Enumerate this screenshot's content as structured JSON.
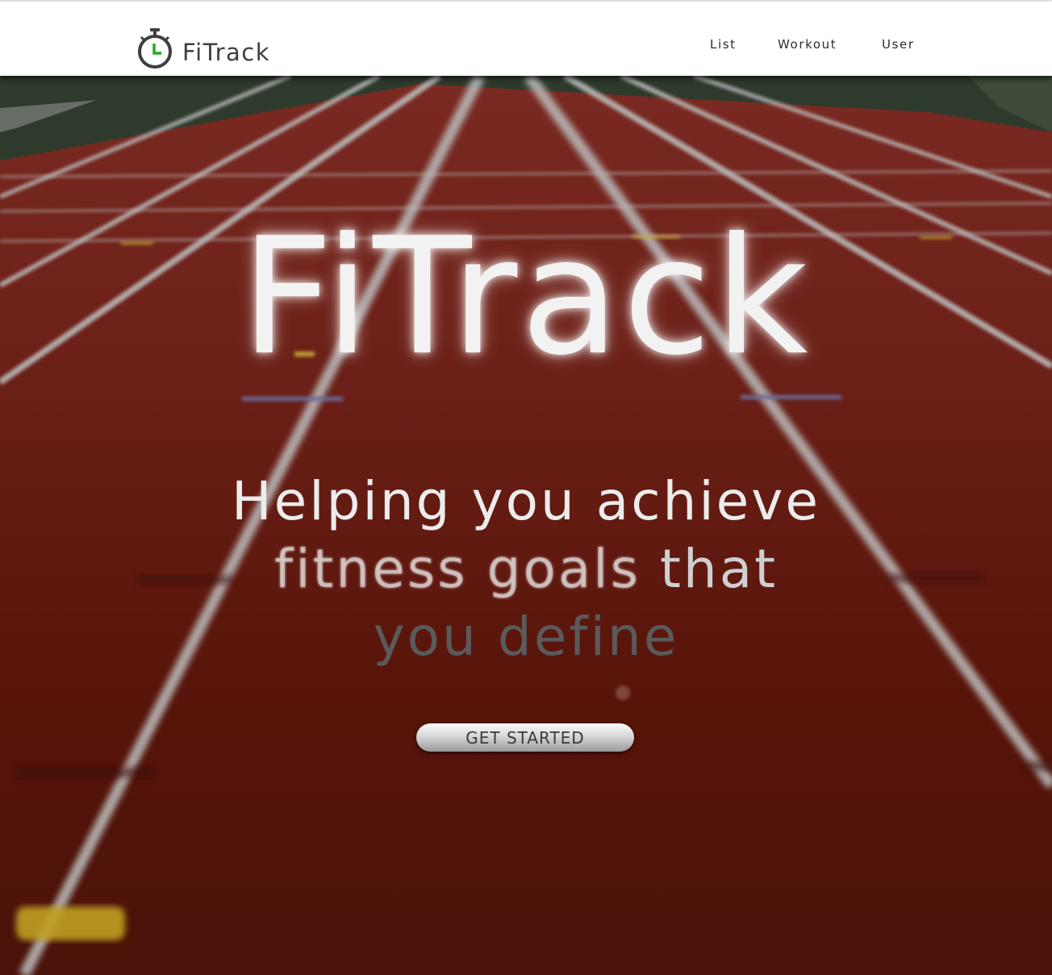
{
  "header": {
    "logo_icon": "stopwatch-icon",
    "brand_name": "FiTrack",
    "nav": [
      {
        "label": "List"
      },
      {
        "label": "Workout"
      },
      {
        "label": "User"
      }
    ]
  },
  "hero": {
    "title": "FiTrack",
    "tagline_line1": "Helping you achieve",
    "tagline_line2a": "fitness goals",
    "tagline_line2b": " that",
    "tagline_line3": "you define",
    "cta_label": "GET STARTED"
  },
  "colors": {
    "track_red": "#5a150e",
    "accent_green": "#22aa22",
    "text_dark": "#3f3f3f"
  }
}
